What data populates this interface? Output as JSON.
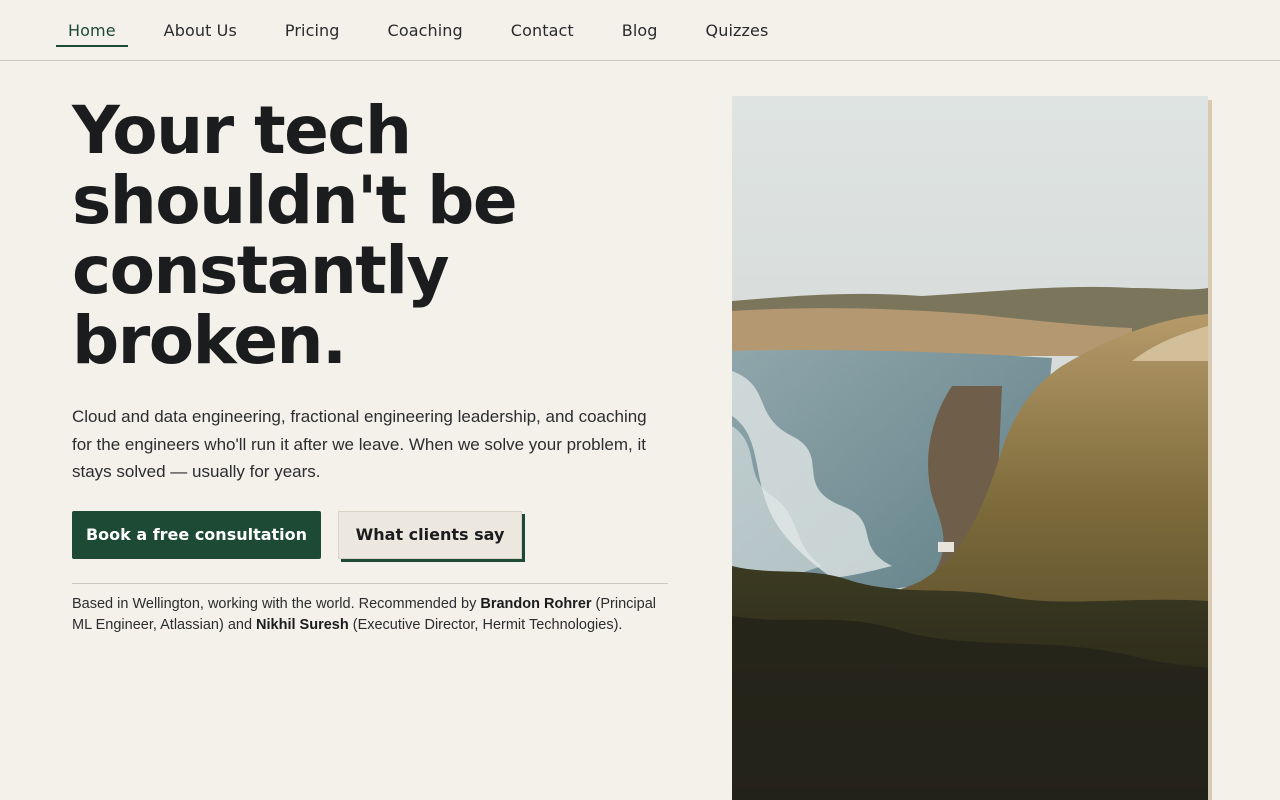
{
  "nav": {
    "items": [
      {
        "label": "Home",
        "active": true
      },
      {
        "label": "About Us",
        "active": false
      },
      {
        "label": "Pricing",
        "active": false
      },
      {
        "label": "Coaching",
        "active": false
      },
      {
        "label": "Contact",
        "active": false
      },
      {
        "label": "Blog",
        "active": false
      },
      {
        "label": "Quizzes",
        "active": false
      }
    ]
  },
  "hero": {
    "headline_lines": [
      "Your tech",
      "shouldn't be",
      "constantly",
      "broken."
    ],
    "lede": "Cloud and data engineering, fractional engineering leadership, and coaching for the engineers who'll run it after we leave. When we solve your problem, it stays solved — usually for years.",
    "primary_cta": "Book a free consultation",
    "secondary_cta": "What clients say",
    "footnote": {
      "prefix": "Based in Wellington, working with the world. Recommended by ",
      "person1_name": "Brandon Rohrer",
      "person1_role": " (Principal ML Engineer, Atlassian) and ",
      "person2_name": "Nikhil Suresh",
      "person2_role": " (Executive Director, Hermit Technologies)."
    }
  },
  "colors": {
    "background": "#f4f1eb",
    "accent": "#1d4a34",
    "text": "#1b1c1e"
  }
}
